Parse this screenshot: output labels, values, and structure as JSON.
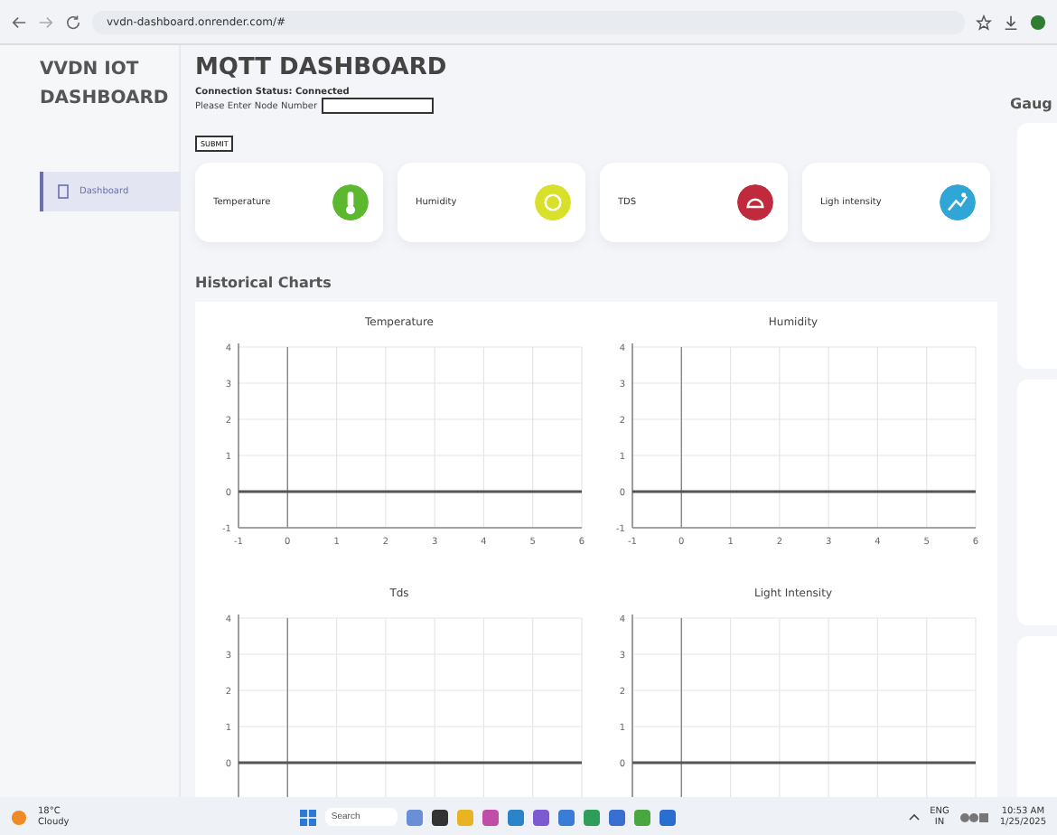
{
  "browser": {
    "url": "vvdn-dashboard.onrender.com/#"
  },
  "sidebar": {
    "title": "VVDN IOT DASHBOARD",
    "items": [
      {
        "label": "Dashboard",
        "selected": true
      }
    ]
  },
  "header": {
    "title": "MQTT DASHBOARD",
    "status": "Connection Status: Connected",
    "node_field": {
      "label": "Please Enter Node Number"
    },
    "submit": "SUBMIT"
  },
  "cards": [
    {
      "label": "Temperature",
      "color": "#5cb82e",
      "kind": "thermometer"
    },
    {
      "label": "Humidity",
      "color": "#d8e02a",
      "kind": "drop"
    },
    {
      "label": "TDS",
      "color": "#c02a3c",
      "kind": "gauge"
    },
    {
      "label": "Ligh intensity",
      "color": "#2fa6d6",
      "kind": "light"
    }
  ],
  "historical": {
    "title": "Historical Charts",
    "charts": [
      {
        "chart_data": {
          "type": "line",
          "title": "Temperature",
          "x": [
            -1,
            0,
            1,
            2,
            3,
            4,
            5,
            6
          ],
          "series": [
            {
              "color": "#555555",
              "values": [
                0,
                0,
                0,
                0,
                0,
                0,
                0,
                0
              ]
            }
          ],
          "grid": true,
          "xlim": [
            -1,
            6
          ],
          "ylim": [
            -1,
            4
          ],
          "xticks": [
            -1,
            0,
            1,
            2,
            3,
            4,
            5,
            6
          ],
          "yticks": [
            -1,
            0,
            1,
            2,
            3,
            4
          ]
        }
      },
      {
        "chart_data": {
          "type": "line",
          "title": "Humidity",
          "x": [
            -1,
            0,
            1,
            2,
            3,
            4,
            5,
            6
          ],
          "series": [
            {
              "color": "#555555",
              "values": [
                0,
                0,
                0,
                0,
                0,
                0,
                0,
                0
              ]
            }
          ],
          "grid": true,
          "xlim": [
            -1,
            6
          ],
          "ylim": [
            -1,
            4
          ],
          "xticks": [
            -1,
            0,
            1,
            2,
            3,
            4,
            5,
            6
          ],
          "yticks": [
            -1,
            0,
            1,
            2,
            3,
            4
          ]
        }
      },
      {
        "chart_data": {
          "type": "line",
          "title": "Tds",
          "series": [
            {
              "color": "#555555",
              "values": [
                0,
                0,
                0,
                0,
                0,
                0,
                0,
                0
              ]
            }
          ],
          "grid": true,
          "ylim": [
            -1,
            4
          ],
          "yticks": [
            0,
            1,
            2,
            3,
            4
          ]
        }
      },
      {
        "chart_data": {
          "type": "line",
          "title": "Light Intensity",
          "series": [
            {
              "color": "#555555",
              "values": [
                0,
                0,
                0,
                0,
                0,
                0,
                0,
                0
              ]
            }
          ],
          "grid": true,
          "ylim": [
            -1,
            4
          ],
          "yticks": [
            0,
            1,
            2,
            3,
            4
          ]
        }
      }
    ]
  },
  "gauges": {
    "title": "Gaug"
  },
  "taskbar": {
    "weather": {
      "temp": "18°C",
      "text": "Cloudy"
    },
    "search": {
      "placeholder": "Search"
    },
    "lang": {
      "top": "ENG",
      "bottom": "IN"
    },
    "time": "10:53 AM",
    "date": "1/25/2025"
  }
}
